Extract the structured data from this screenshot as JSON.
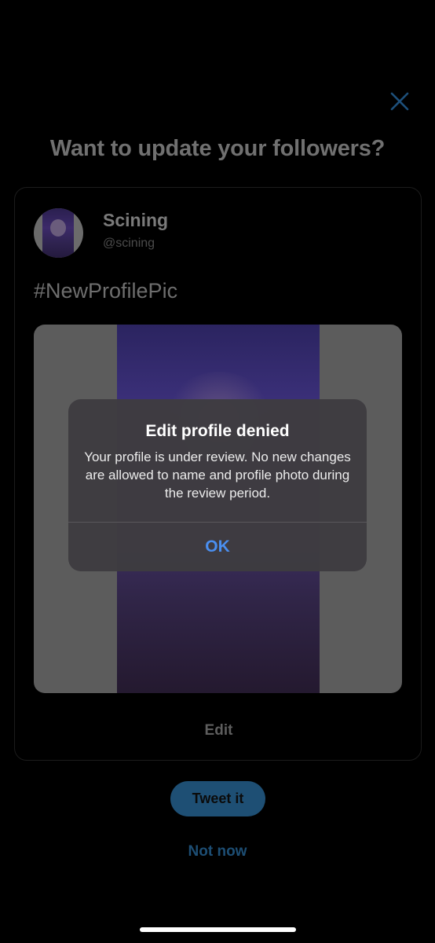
{
  "sheet": {
    "headline": "Want to update your followers?",
    "close_icon": "close-icon"
  },
  "tweet_preview": {
    "display_name": "Scining",
    "handle": "@scining",
    "text": "#NewProfilePic",
    "edit_label": "Edit"
  },
  "actions": {
    "tweet_it_label": "Tweet it",
    "not_now_label": "Not now"
  },
  "alert": {
    "title": "Edit profile denied",
    "message": "Your profile is under review. No new changes are allowed to name and profile photo during the review period.",
    "ok_label": "OK"
  },
  "colors": {
    "accent": "#4a8ff0",
    "dimmed_accent": "#1e4f74",
    "background": "#000000",
    "alert_background": "#3e3c40"
  }
}
